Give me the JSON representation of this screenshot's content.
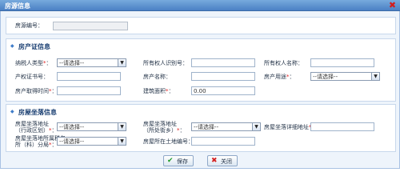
{
  "window": {
    "title": "房源信息"
  },
  "house": {
    "label": "房源编号：",
    "value": ""
  },
  "cert_section": {
    "title": "房产证信息",
    "taxpayer_type": {
      "label": "纳税人类型",
      "mark": "*",
      "colon": "：",
      "value": "--请选择--"
    },
    "owner_id": {
      "label": "所有权人识别号：",
      "value": ""
    },
    "owner_name": {
      "label": "所有权人名称：",
      "value": ""
    },
    "cert_no": {
      "label": "产权证书号：",
      "value": ""
    },
    "property_name": {
      "label": "房产名称：",
      "value": ""
    },
    "usage": {
      "label": "房产用途",
      "mark": "*",
      "colon": "：",
      "value": "--请选择--"
    },
    "acquire_time": {
      "label": "房产取得时间",
      "mark": "*",
      "colon": "：",
      "value": ""
    },
    "area": {
      "label": "建筑面积",
      "mark": "*",
      "colon": "：",
      "value": "0.00"
    }
  },
  "location_section": {
    "title": "房屋坐落信息",
    "region": {
      "label_line1": "房屋坐落地址",
      "label_line2": "（行政区划）",
      "mark": "*",
      "colon": "：",
      "value": "--请选择--"
    },
    "street": {
      "label_line1": "房屋坐落地址",
      "label_line2": "（所处街乡）",
      "mark": "*",
      "colon": "：",
      "value": "--请选择--"
    },
    "detail": {
      "label": "房屋坐落详细地址",
      "mark": "*",
      "colon": "：",
      "value": ""
    },
    "tax_office": {
      "label_line1": "房屋坐落地所属税务",
      "label_line2": "所（科）分局",
      "mark": "*",
      "colon": "：",
      "value": "--请选择--"
    },
    "land_no": {
      "label": "房屋所在土地编号：",
      "value": ""
    }
  },
  "buttons": {
    "save": "保存",
    "close": "关闭"
  },
  "colors": {
    "titlebar": "#5a8fd0",
    "required": "#e02020",
    "section_title": "#1a3f72"
  }
}
